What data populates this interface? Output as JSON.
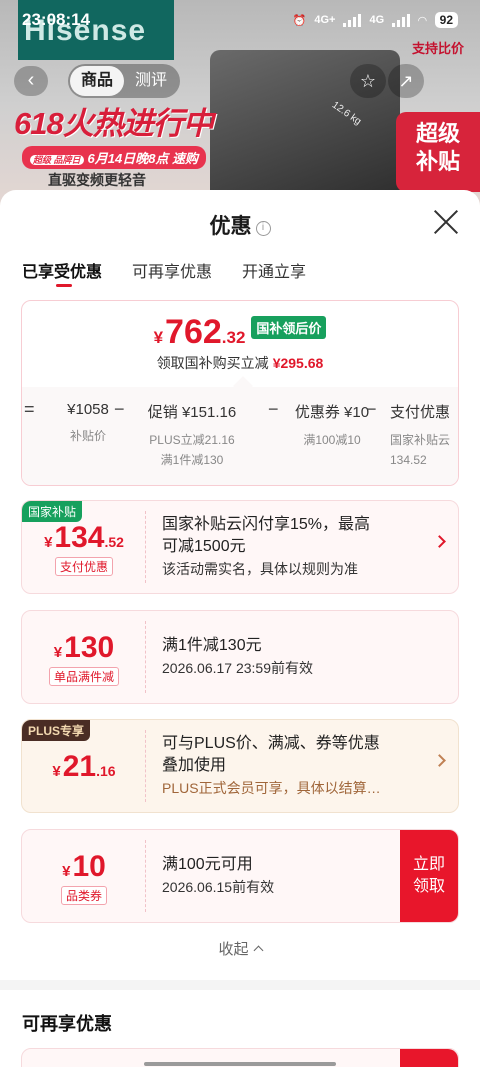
{
  "status_bar": {
    "time": "23:08:14",
    "network_1": "4G+",
    "network_2": "4G",
    "battery": "92"
  },
  "background": {
    "brand": "Hisense",
    "nav_tabs": [
      "商品",
      "测评"
    ],
    "promo_title": "618火热进行中",
    "promo_time": "6月14日晚8点 速购",
    "promo_time_tag": "超级 品牌日",
    "promo_sub": "直驱变频更轻音",
    "compare_label": "支持比价",
    "subsidy_badge": "超级补贴",
    "washer_label": "12.6 kg"
  },
  "sheet": {
    "title": "优惠",
    "tabs": [
      "已享受优惠",
      "可再享优惠",
      "开通立享"
    ],
    "summary": {
      "yen": "¥",
      "price_int": "762",
      "price_dec": ".32",
      "price_tag": "国补领后价",
      "save_text": "领取国补购买立减",
      "save_amount": "¥295.68",
      "breakdown": [
        {
          "op": "=",
          "value": "¥1058",
          "label": "补贴价",
          "label2": ""
        },
        {
          "op": "−",
          "value": "促销 ¥151.16",
          "label": "PLUS立减21.16",
          "label2": "满1件减130"
        },
        {
          "op": "−",
          "value": "优惠券 ¥10",
          "label": "满100减10",
          "label2": ""
        },
        {
          "op": "−",
          "value": "支付优惠",
          "label": "国家补贴云",
          "label2": "134.52"
        }
      ]
    },
    "coupons": [
      {
        "corner": "国家补贴",
        "yen": "¥",
        "int": "134",
        "dec": ".52",
        "tag": "支付优惠",
        "line1": "国家补贴云闪付享15%，最高",
        "line1b": "可减1500元",
        "line2": "该活动需实名，具体以规则为准"
      },
      {
        "yen": "¥",
        "int": "130",
        "dec": "",
        "tag": "单品满件减",
        "line1": "满1件减130元",
        "line2": "2026.06.17 23:59前有效"
      },
      {
        "corner": "PLUS专享",
        "yen": "¥",
        "int": "21",
        "dec": ".16",
        "line1": "可与PLUS价、满减、券等优惠",
        "line1b": "叠加使用",
        "line2": "PLUS正式会员可享，具体以结算…"
      },
      {
        "yen": "¥",
        "int": "10",
        "dec": "",
        "tag": "品类券",
        "line1": "满100元可用",
        "line2": "2026.06.15前有效",
        "button": "立即领取"
      }
    ],
    "collapse_label": "收起",
    "more_section_title": "可再享优惠"
  },
  "colors": {
    "accent": "#e0182b",
    "subsidy_green": "#17a05d",
    "plus_brown": "#4a2d24"
  }
}
